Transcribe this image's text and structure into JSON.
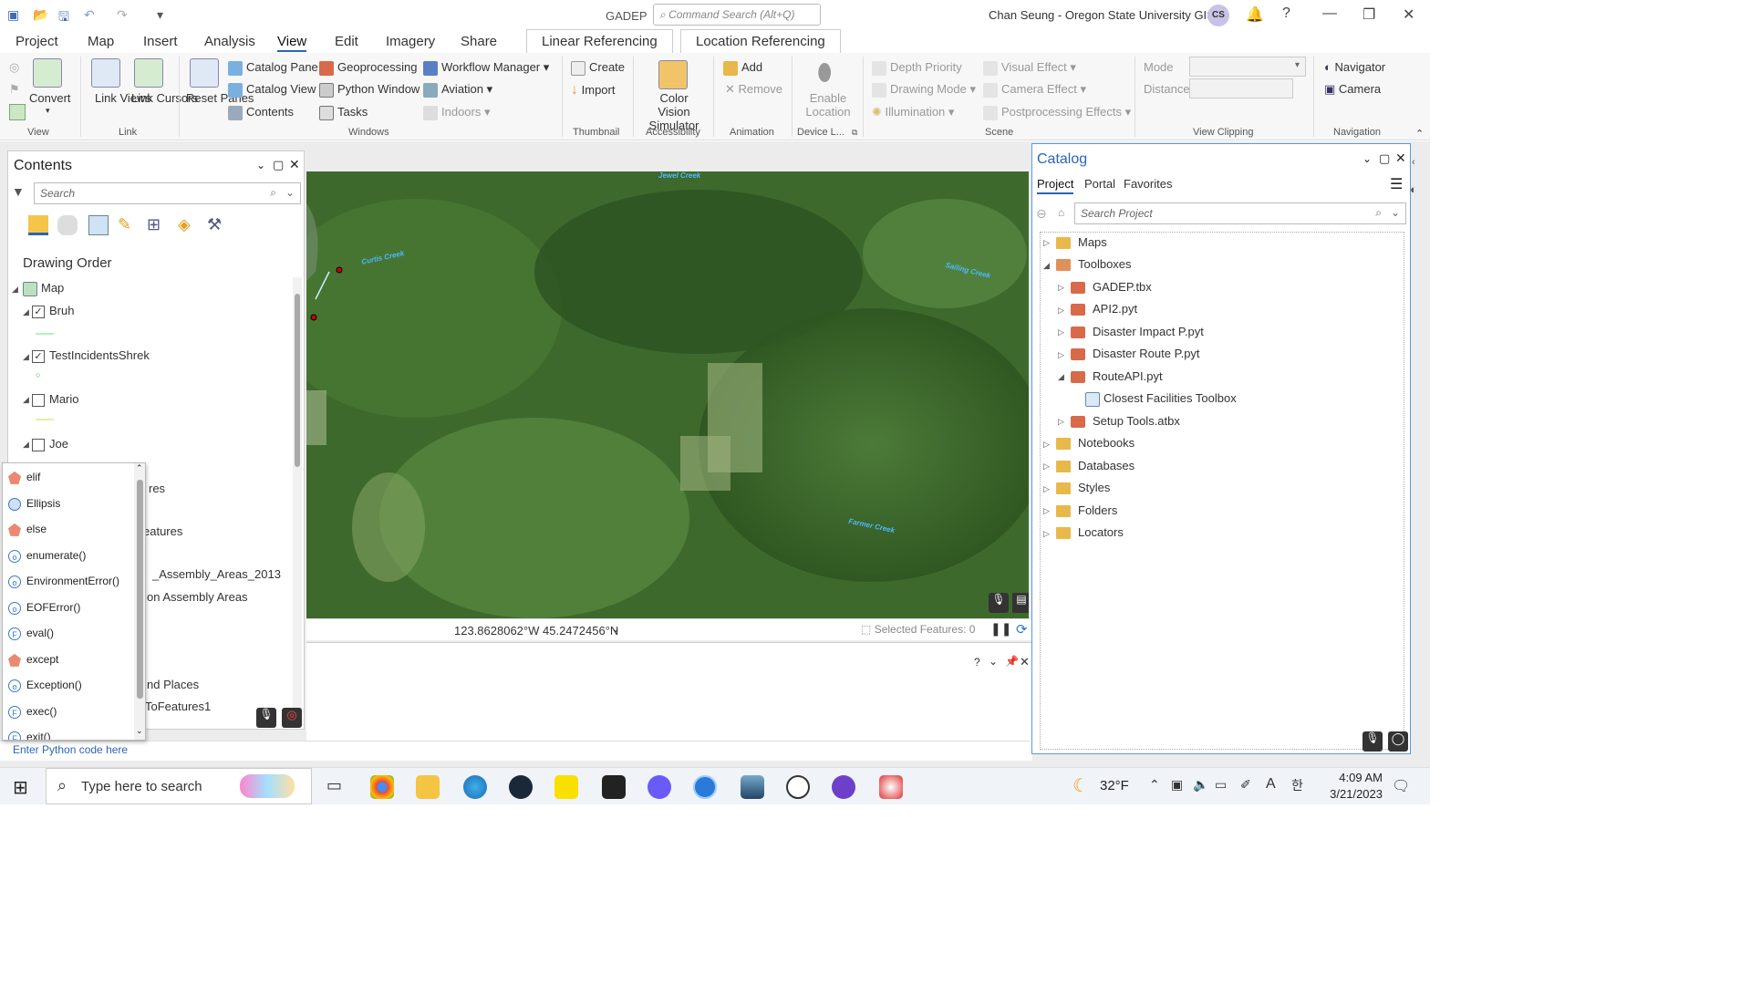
{
  "app": {
    "title": "GADEP",
    "command_search_placeholder": "Command Search (Alt+Q)",
    "user": "Chan Seung - Oregon State University GISci",
    "avatar_initials": "CS"
  },
  "menu": [
    "Project",
    "Map",
    "Insert",
    "Analysis",
    "View",
    "Edit",
    "Imagery",
    "Share"
  ],
  "context_tabs": [
    "Linear Referencing",
    "Location Referencing"
  ],
  "ribbon": {
    "view": {
      "convert": "Convert",
      "label": "View"
    },
    "link": {
      "link_views": "Link Views",
      "link_cursors": "Link Cursors",
      "label": "Link"
    },
    "windows": {
      "reset_panes": "Reset Panes",
      "catalog_pane": "Catalog Pane",
      "catalog_view": "Catalog View",
      "contents": "Contents",
      "geoprocessing": "Geoprocessing",
      "python_window": "Python Window",
      "tasks": "Tasks",
      "workflow_manager": "Workflow Manager",
      "aviation": "Aviation",
      "indoors": "Indoors",
      "label": "Windows"
    },
    "thumbnail": {
      "create": "Create",
      "import": "Import",
      "label": "Thumbnail"
    },
    "accessibility": {
      "color_vision": "Color Vision Simulator",
      "label": "Accessibility"
    },
    "animation": {
      "add": "Add",
      "remove": "Remove",
      "label": "Animation"
    },
    "device": {
      "enable_location": "Enable Location",
      "label": "Device L..."
    },
    "scene": {
      "depth_priority": "Depth Priority",
      "drawing_mode": "Drawing Mode",
      "illumination": "Illumination",
      "visual_effect": "Visual Effect",
      "camera_effect": "Camera Effect",
      "postprocessing": "Postprocessing Effects",
      "label": "Scene"
    },
    "clipping": {
      "mode": "Mode",
      "distance": "Distance",
      "label": "View Clipping"
    },
    "navigation": {
      "navigator": "Navigator",
      "camera": "Camera",
      "label": "Navigation"
    }
  },
  "contents": {
    "title": "Contents",
    "search_placeholder": "Search",
    "heading": "Drawing Order",
    "map_label": "Map",
    "layers": [
      {
        "name": "Bruh",
        "checked": true
      },
      {
        "name": "TestIncidentsShrek",
        "checked": true
      },
      {
        "name": "Mario",
        "checked": false
      },
      {
        "name": "Joe",
        "checked": false
      }
    ],
    "hidden_fragments": [
      "res",
      "eatures",
      "_Assembly_Areas_2013",
      "on Assembly Areas",
      "nd Places",
      "ToFeatures1"
    ]
  },
  "autocomplete": [
    {
      "label": "elif",
      "kind": "keyword"
    },
    {
      "label": "Ellipsis",
      "kind": "constant"
    },
    {
      "label": "else",
      "kind": "keyword"
    },
    {
      "label": "enumerate()",
      "kind": "class"
    },
    {
      "label": "EnvironmentError()",
      "kind": "class"
    },
    {
      "label": "EOFError()",
      "kind": "class"
    },
    {
      "label": "eval()",
      "kind": "function"
    },
    {
      "label": "except",
      "kind": "keyword"
    },
    {
      "label": "Exception()",
      "kind": "class"
    },
    {
      "label": "exec()",
      "kind": "function"
    },
    {
      "label": "exit()",
      "kind": "function"
    }
  ],
  "map": {
    "creeks": [
      "Jewel Creek",
      "Curtis Creek",
      "Sailing Creek",
      "Farmer Creek"
    ],
    "coordinates": "123.8628062°W 45.2472456°N",
    "selected_features": "Selected Features: 0"
  },
  "python": {
    "placeholder": "Enter Python code here"
  },
  "catalog": {
    "title": "Catalog",
    "tabs": [
      "Project",
      "Portal",
      "Favorites"
    ],
    "search_placeholder": "Search Project",
    "items": {
      "maps": "Maps",
      "toolboxes": "Toolboxes",
      "gadep": "GADEP.tbx",
      "api2": "API2.pyt",
      "disaster_impact": "Disaster Impact P.pyt",
      "disaster_route": "Disaster Route P.pyt",
      "routeapi": "RouteAPI.pyt",
      "closest": "Closest Facilities Toolbox",
      "setup": "Setup Tools.atbx",
      "notebooks": "Notebooks",
      "databases": "Databases",
      "styles": "Styles",
      "folders": "Folders",
      "locators": "Locators"
    }
  },
  "taskbar": {
    "search_placeholder": "Type here to search",
    "temperature": "32°F",
    "time": "4:09 AM",
    "date": "3/21/2023"
  },
  "colors": {
    "accent": "#2b64b8",
    "catalog_border": "#5a9bd5",
    "map_green": "#3d6a2c"
  }
}
